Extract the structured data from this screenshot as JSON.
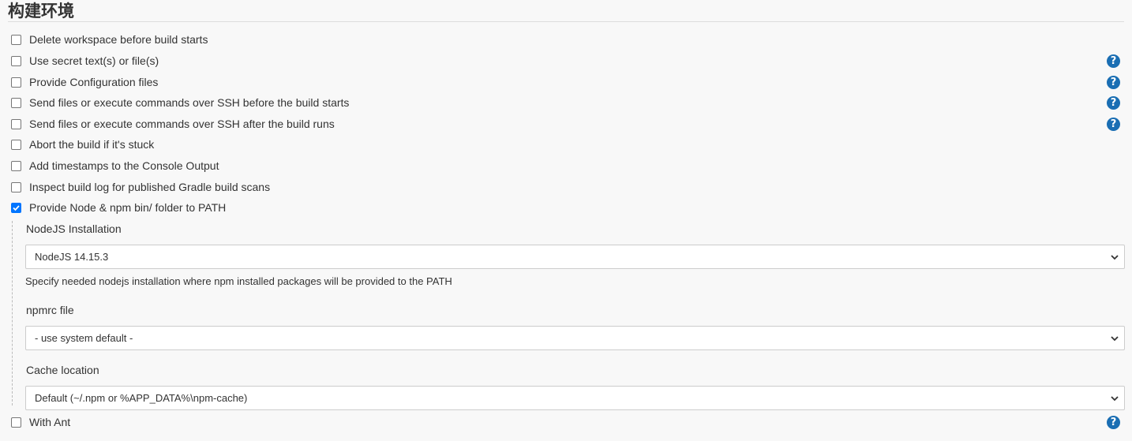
{
  "section": {
    "title": "构建环境"
  },
  "options": [
    {
      "label": "Delete workspace before build starts",
      "checked": false,
      "help": false
    },
    {
      "label": "Use secret text(s) or file(s)",
      "checked": false,
      "help": true
    },
    {
      "label": "Provide Configuration files",
      "checked": false,
      "help": true
    },
    {
      "label": "Send files or execute commands over SSH before the build starts",
      "checked": false,
      "help": true
    },
    {
      "label": "Send files or execute commands over SSH after the build runs",
      "checked": false,
      "help": true
    },
    {
      "label": "Abort the build if it's stuck",
      "checked": false,
      "help": false
    },
    {
      "label": "Add timestamps to the Console Output",
      "checked": false,
      "help": false
    },
    {
      "label": "Inspect build log for published Gradle build scans",
      "checked": false,
      "help": false
    },
    {
      "label": "Provide Node & npm bin/ folder to PATH",
      "checked": true,
      "help": false
    }
  ],
  "node": {
    "installation_label": "NodeJS Installation",
    "installation_value": "NodeJS  14.15.3",
    "installation_desc": "Specify needed nodejs installation where npm installed packages will be provided to the PATH",
    "npmrc_label": "npmrc file",
    "npmrc_value": "- use system default -",
    "cache_label": "Cache location",
    "cache_value": "Default (~/.npm or %APP_DATA%\\npm-cache)"
  },
  "last_option": {
    "label": "With Ant",
    "checked": false,
    "help": true
  },
  "help_glyph": "?"
}
